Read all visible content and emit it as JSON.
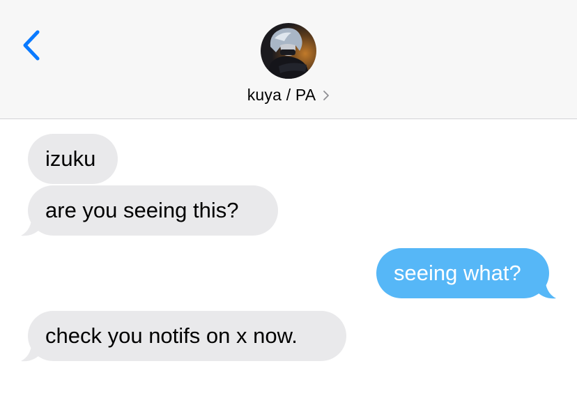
{
  "header": {
    "back_icon": "chevron-left-icon",
    "contact_name": "kuya / PA",
    "contact_chevron": "›",
    "avatar": "contact-avatar"
  },
  "colors": {
    "header_bg": "#f7f7f7",
    "accent": "#0a7aff",
    "incoming_bubble": "#e9e9eb",
    "outgoing_bubble": "#56b7f7",
    "outgoing_text": "#ffffff",
    "incoming_text": "#000000"
  },
  "messages": [
    {
      "direction": "incoming",
      "text": "izuku"
    },
    {
      "direction": "incoming",
      "text": "are you seeing this?"
    },
    {
      "direction": "outgoing",
      "text": "seeing what?"
    },
    {
      "direction": "incoming",
      "text": "check you notifs on x now."
    }
  ]
}
